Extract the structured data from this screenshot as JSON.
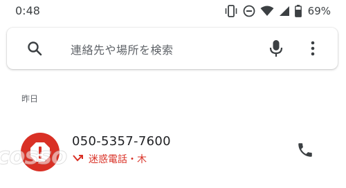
{
  "status_bar": {
    "time": "0:48",
    "battery_percent": "69%",
    "icons": [
      "vibrate-icon",
      "do-not-disturb-icon",
      "wifi-icon",
      "signal-icon",
      "battery-icon"
    ]
  },
  "search": {
    "placeholder": "連絡先や場所を検索",
    "icons": [
      "search-icon",
      "mic-icon",
      "more-vert-icon"
    ]
  },
  "recents": {
    "section_label": "昨日",
    "calls": [
      {
        "number": "050-5357-7600",
        "status_label": "迷惑電話・木",
        "call_type_icon": "missed-call-icon",
        "avatar_icon": "spam-warning-icon",
        "action_icon": "phone-icon"
      }
    ]
  },
  "watermark": "cosso",
  "colors": {
    "accent_red": "#d93025",
    "text_primary": "#202124",
    "text_secondary": "#5f6368"
  }
}
